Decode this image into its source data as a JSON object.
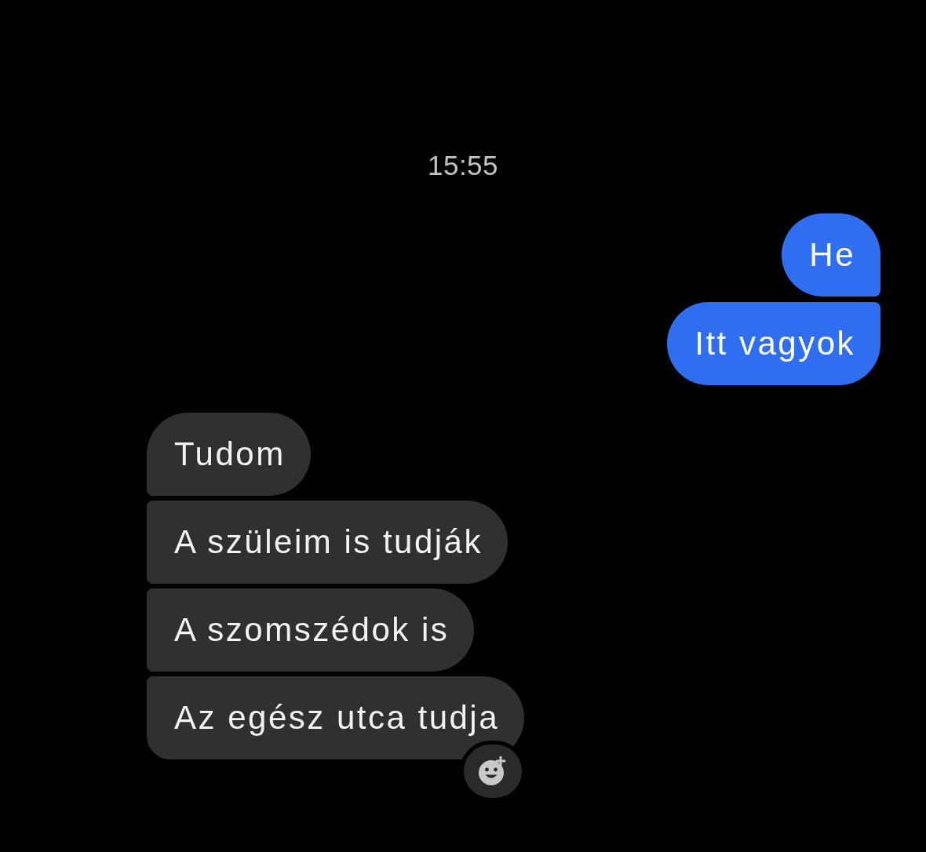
{
  "timestamp": "15:55",
  "groups": [
    {
      "kind": "outgoing",
      "messages": [
        "He",
        "Itt vagyok"
      ]
    },
    {
      "kind": "incoming",
      "messages": [
        "Tudom",
        "A szüleim is tudják",
        "A szomszédok is",
        "Az egész utca tudja"
      ],
      "reaction_button": true
    }
  ]
}
